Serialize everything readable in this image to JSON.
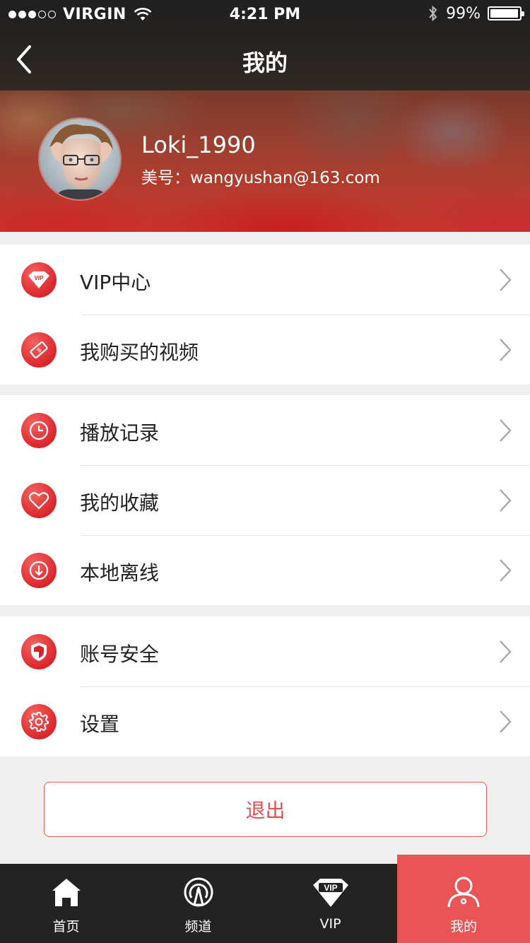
{
  "status_bar": {
    "carrier": "VIRGIN",
    "time": "4:21 PM",
    "battery": "99%",
    "signal_bars_filled": 3,
    "signal_bars_total": 5,
    "battery_level": 0.99
  },
  "nav": {
    "title": "我的",
    "back_icon": "chevron-left-icon"
  },
  "profile": {
    "username": "Loki_1990",
    "account": "美号：wangyushan@163.com",
    "avatar_icon": "avatar"
  },
  "menu_groups": [
    {
      "items": [
        {
          "label": "VIP中心",
          "icon": "vip-diamond-icon"
        },
        {
          "label": "我购买的视频",
          "icon": "ticket-icon"
        }
      ]
    },
    {
      "items": [
        {
          "label": "播放记录",
          "icon": "clock-icon"
        },
        {
          "label": "我的收藏",
          "icon": "heart-icon"
        },
        {
          "label": "本地离线",
          "icon": "download-icon"
        }
      ]
    },
    {
      "items": [
        {
          "label": "账号安全",
          "icon": "shield-icon"
        },
        {
          "label": "设置",
          "icon": "gear-icon"
        }
      ]
    }
  ],
  "logout_label": "退出",
  "tabbar": {
    "tabs": [
      {
        "label": "首页",
        "icon": "home-icon"
      },
      {
        "label": "频道",
        "icon": "broadcast-icon"
      },
      {
        "label": "VIP",
        "icon": "vip-diamond-icon"
      },
      {
        "label": "我的",
        "icon": "user-icon"
      }
    ],
    "active_index": 3
  },
  "colors": {
    "accent": "#ea5455",
    "icon_red": "#d92329",
    "tabbar_bg": "#232323",
    "page_bg": "#f0f0f0"
  }
}
